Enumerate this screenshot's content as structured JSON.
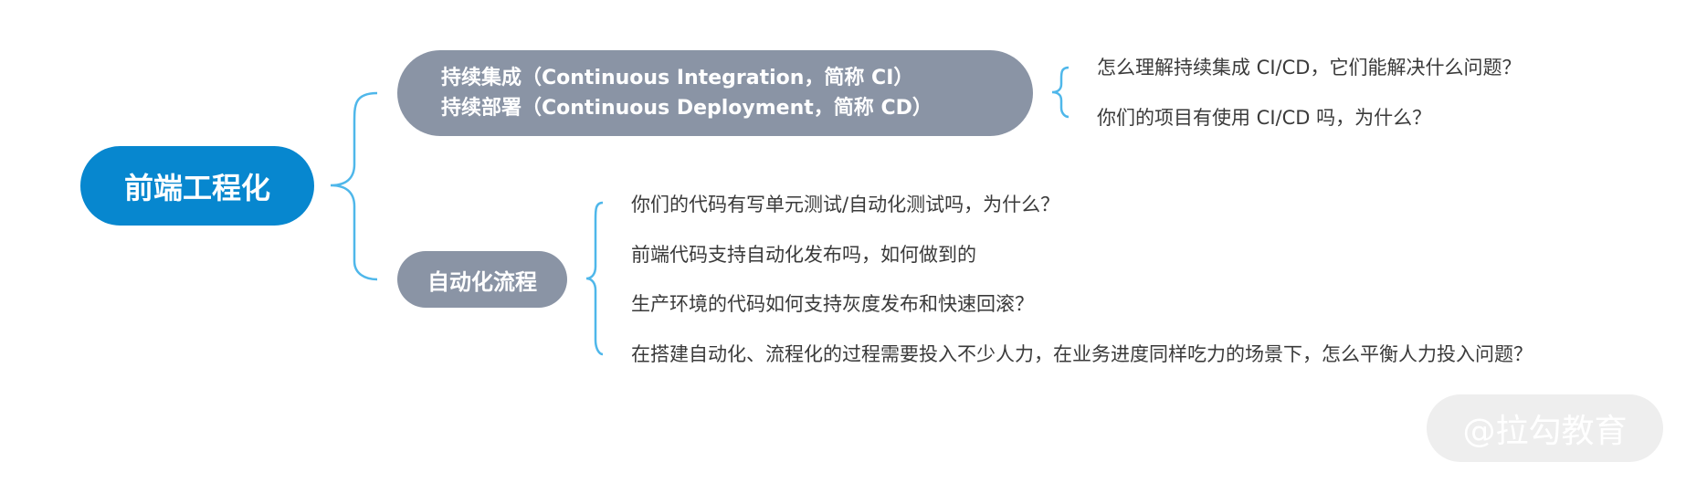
{
  "colors": {
    "root_fill": "#0787cf",
    "branch_fill": "#8a94a5",
    "connector": "#4fb7ea",
    "leaf_text": "#3a3a3a",
    "watermark_fill": "#eeeeee",
    "watermark_text": "#ffffff"
  },
  "root": {
    "label": "前端工程化"
  },
  "branches": [
    {
      "lines": [
        "持续集成（Continuous Integration，简称 CI）",
        "持续部署（Continuous Deployment，简称 CD）"
      ],
      "children": [
        "怎么理解持续集成 CI/CD，它们能解决什么问题？",
        "你们的项目有使用 CI/CD 吗，为什么？"
      ]
    },
    {
      "lines": [
        "自动化流程"
      ],
      "children": [
        "你们的代码有写单元测试/自动化测试吗，为什么？",
        "前端代码支持自动化发布吗，如何做到的",
        "生产环境的代码如何支持灰度发布和快速回滚？",
        "在搭建自动化、流程化的过程需要投入不少人力，在业务进度同样吃力的场景下，怎么平衡人力投入问题？"
      ]
    }
  ],
  "watermark": "@拉勾教育"
}
